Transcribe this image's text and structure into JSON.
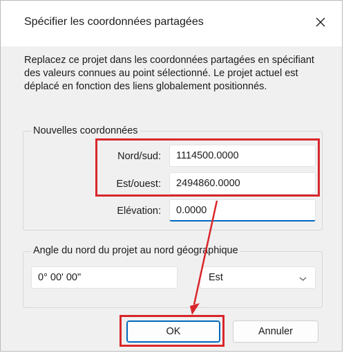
{
  "dialog": {
    "title": "Spécifier les coordonnées partagées",
    "description": "Replacez ce projet dans les coordonnées partagées en spécifiant des valeurs connues au point sélectionné. Le projet actuel est déplacé en fonction des liens globalement positionnés."
  },
  "new_coordinates": {
    "group_label": "Nouvelles coordonnées",
    "north_south_label": "Nord/sud:",
    "north_south_value": "1114500.0000",
    "east_west_label": "Est/ouest:",
    "east_west_value": "2494860.0000",
    "elevation_label": "Elévation:",
    "elevation_value": "0.0000"
  },
  "angle": {
    "group_label": "Angle du nord du projet au nord géographique",
    "angle_value": "0° 00' 00\"",
    "direction_selected": "Est"
  },
  "buttons": {
    "ok_label": "OK",
    "cancel_label": "Annuler"
  },
  "annotation": {
    "highlight_color": "#d9262a",
    "accent_color": "#0067c0"
  }
}
